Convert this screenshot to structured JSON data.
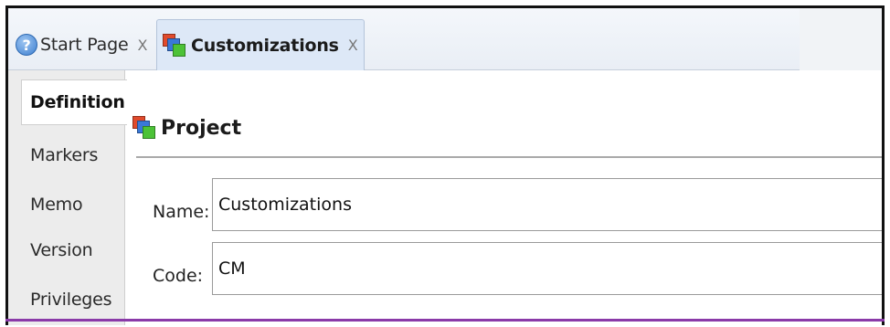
{
  "tabs": [
    {
      "label": "Start Page",
      "close": "X",
      "icon": "help-icon"
    },
    {
      "label": "Customizations",
      "close": "X",
      "icon": "stack-icon"
    }
  ],
  "side_tabs": [
    "Definition",
    "Markers",
    "Memo",
    "Version",
    "Privileges"
  ],
  "section": {
    "title": "Project",
    "icon": "stack-icon"
  },
  "fields": {
    "name": {
      "label": "Name:",
      "value": "Customizations"
    },
    "code": {
      "label": "Code:",
      "value": "CM"
    }
  },
  "colors": {
    "accent_bottom": "#8a3aa8",
    "active_tab": "#dde8f7"
  }
}
